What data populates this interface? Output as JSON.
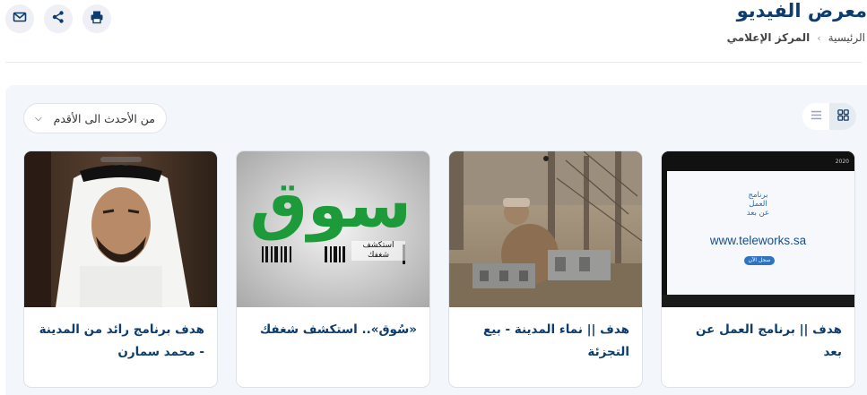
{
  "header": {
    "title": "معرض الفيديو",
    "breadcrumb": [
      "الرئيسية",
      "المركز الإعلامي"
    ],
    "breadcrumb_separator": "›"
  },
  "actions": {
    "icons": [
      "print-icon",
      "share-icon",
      "mail-icon"
    ],
    "button_bg": "#eef0f5",
    "icon_color": "#0c3d6e"
  },
  "toolbar": {
    "sort_value": "من الأحدث الى الأقدم",
    "view_modes": [
      "grid-icon",
      "list-icon"
    ],
    "active_view": "grid"
  },
  "videos": [
    {
      "title": "هدف || برنامج العمل عن بعد",
      "thumb": {
        "url_text": "www.teleworks.sa",
        "program_text": "برنامج\nالعمل\nعن بعد",
        "cta_text": "سجل الآن",
        "year_text": "2020"
      }
    },
    {
      "title": "هدف || نماء المدينة - بيع التجزئة",
      "thumb": {}
    },
    {
      "title": "«سُوق».. استكشف شغفك",
      "thumb": {
        "logo_text": "سوق",
        "tagline": "استكشف شغفك"
      }
    },
    {
      "title": "هدف برنامج رائد من المدينة - محمد سمارن",
      "thumb": {}
    }
  ],
  "colors": {
    "primary": "#0c3d6e",
    "panel_bg": "#f3f6fa",
    "soq_green": "#1d9b3a"
  }
}
